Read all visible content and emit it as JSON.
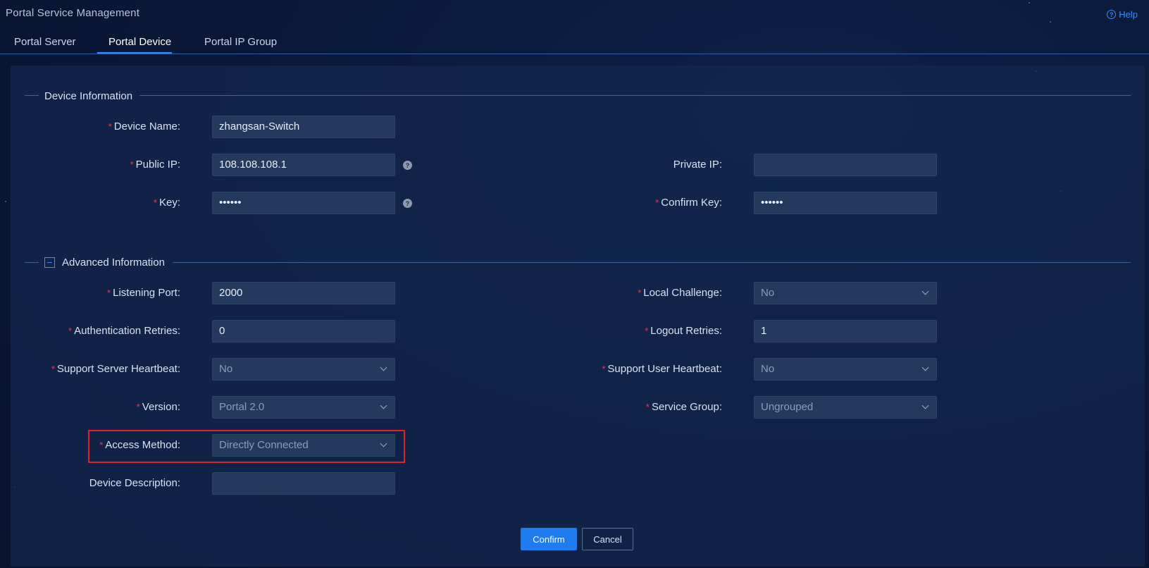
{
  "app": {
    "title": "Portal Service Management",
    "help_label": "Help",
    "help_icon": "help-circle-icon"
  },
  "tabs": [
    {
      "label": "Portal Server",
      "active": false
    },
    {
      "label": "Portal Device",
      "active": true
    },
    {
      "label": "Portal IP Group",
      "active": false
    }
  ],
  "sections": {
    "device_info": "Device Information",
    "advanced_info": "Advanced Information"
  },
  "fields": {
    "device_name": {
      "label": "Device Name:",
      "value": "zhangsan-Switch",
      "required": "*"
    },
    "public_ip": {
      "label": "Public IP:",
      "value": "108.108.108.1",
      "required": "*",
      "help_icon": "?"
    },
    "private_ip": {
      "label": "Private IP:",
      "value": ""
    },
    "key": {
      "label": "Key:",
      "value": "••••••",
      "required": "*",
      "help_icon": "?"
    },
    "confirm_key": {
      "label": "Confirm Key:",
      "value": "••••••",
      "required": "*"
    },
    "listening_port": {
      "label": "Listening Port:",
      "value": "2000",
      "required": "*"
    },
    "local_challenge": {
      "label": "Local Challenge:",
      "value": "No",
      "required": "*"
    },
    "auth_retries": {
      "label": "Authentication Retries:",
      "value": "0",
      "required": "*"
    },
    "logout_retries": {
      "label": "Logout Retries:",
      "value": "1",
      "required": "*"
    },
    "server_heartbeat": {
      "label": "Support Server Heartbeat:",
      "value": "No",
      "required": "*"
    },
    "user_heartbeat": {
      "label": "Support User Heartbeat:",
      "value": "No",
      "required": "*"
    },
    "version": {
      "label": "Version:",
      "value": "Portal 2.0",
      "required": "*"
    },
    "service_group": {
      "label": "Service Group:",
      "value": "Ungrouped",
      "required": "*"
    },
    "access_method": {
      "label": "Access Method:",
      "value": "Directly Connected",
      "required": "*"
    },
    "device_description": {
      "label": "Device Description:",
      "value": ""
    }
  },
  "buttons": {
    "confirm": "Confirm",
    "cancel": "Cancel"
  },
  "colors": {
    "accent": "#1e7cf0",
    "required": "#e8384f",
    "highlight": "#e0202a",
    "background": "#0a1938"
  }
}
